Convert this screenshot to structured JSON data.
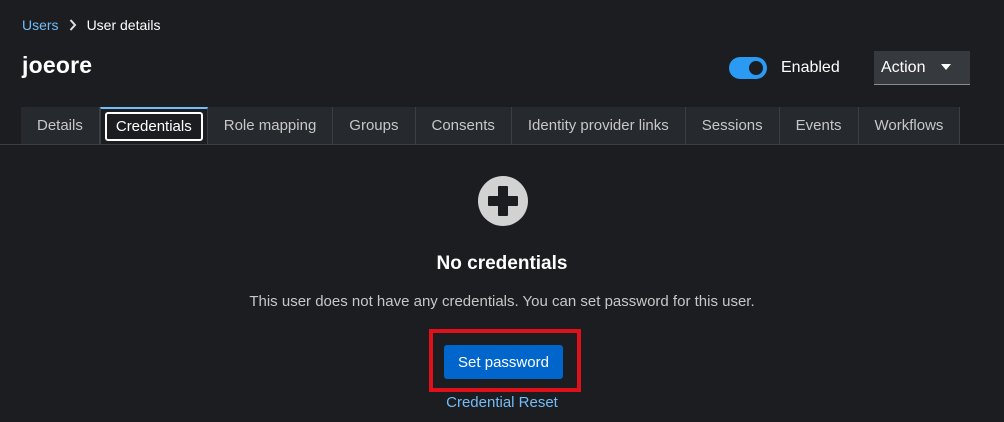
{
  "breadcrumb": {
    "parent": "Users",
    "current": "User details"
  },
  "header": {
    "title": "joeore",
    "toggle_label": "Enabled",
    "toggle_on": true,
    "action_label": "Action"
  },
  "tabs": [
    {
      "label": "Details"
    },
    {
      "label": "Credentials",
      "active": true
    },
    {
      "label": "Role mapping"
    },
    {
      "label": "Groups"
    },
    {
      "label": "Consents"
    },
    {
      "label": "Identity provider links"
    },
    {
      "label": "Sessions"
    },
    {
      "label": "Events"
    },
    {
      "label": "Workflows"
    }
  ],
  "empty_state": {
    "icon": "plus-circle-icon",
    "title": "No credentials",
    "body": "This user does not have any credentials. You can set password for this user.",
    "primary_label": "Set password",
    "link_label": "Credential Reset"
  },
  "colors": {
    "accent": "#73bcf7",
    "primary": "#0066cc",
    "toggle_on": "#2b9af3",
    "highlight": "#e0101a",
    "background": "#1b1d21"
  }
}
